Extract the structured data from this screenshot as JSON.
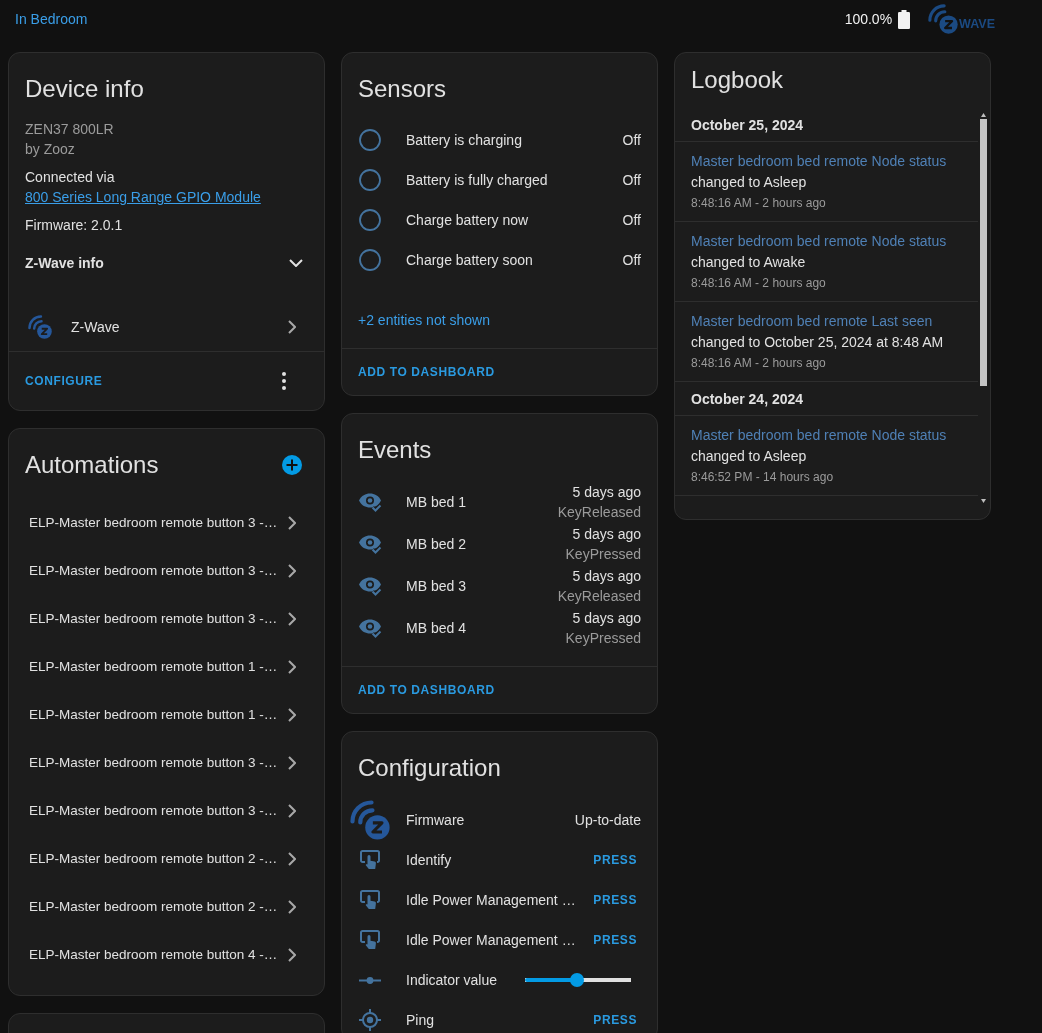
{
  "header": {
    "area_link": "In Bedroom",
    "battery_level": "100.0%",
    "logo_text": "WAVE"
  },
  "device_info": {
    "title": "Device info",
    "model": "ZEN37 800LR",
    "manufacturer": "by Zooz",
    "connected_via": "Connected via",
    "hub_link": "800 Series Long Range GPIO Module",
    "firmware": "Firmware: 2.0.1",
    "zwave_info": {
      "label": "Z-Wave info",
      "expanded": false
    },
    "integration": "Z-Wave",
    "action": "CONFIGURE"
  },
  "automations": {
    "title": "Automations",
    "items": [
      "ELP-Master bedroom remote button 3 -…",
      "ELP-Master bedroom remote button 3 -…",
      "ELP-Master bedroom remote button 3 -…",
      "ELP-Master bedroom remote button 1 -…",
      "ELP-Master bedroom remote button 1 -…",
      "ELP-Master bedroom remote button 3 -…",
      "ELP-Master bedroom remote button 3 -…",
      "ELP-Master bedroom remote button 2 -…",
      "ELP-Master bedroom remote button 2 -…",
      "ELP-Master bedroom remote button 4 -…"
    ]
  },
  "sensors": {
    "title": "Sensors",
    "items": [
      {
        "name": "Battery is charging",
        "state": "Off"
      },
      {
        "name": "Battery is fully charged",
        "state": "Off"
      },
      {
        "name": "Charge battery now",
        "state": "Off"
      },
      {
        "name": "Charge battery soon",
        "state": "Off"
      }
    ],
    "more": "+2 entities not shown",
    "action": "ADD TO DASHBOARD"
  },
  "events": {
    "title": "Events",
    "items": [
      {
        "name": "MB bed 1",
        "time": "5 days ago",
        "event": "KeyReleased"
      },
      {
        "name": "MB bed 2",
        "time": "5 days ago",
        "event": "KeyPressed"
      },
      {
        "name": "MB bed 3",
        "time": "5 days ago",
        "event": "KeyReleased"
      },
      {
        "name": "MB bed 4",
        "time": "5 days ago",
        "event": "KeyPressed"
      }
    ],
    "action": "ADD TO DASHBOARD"
  },
  "configuration": {
    "title": "Configuration",
    "items": [
      {
        "kind": "firmware",
        "name": "Firmware",
        "value": "Up-to-date"
      },
      {
        "kind": "button",
        "name": "Identify",
        "action": "PRESS"
      },
      {
        "kind": "button",
        "name": "Idle Power Management …",
        "action": "PRESS"
      },
      {
        "kind": "button",
        "name": "Idle Power Management …",
        "action": "PRESS"
      },
      {
        "kind": "slider",
        "name": "Indicator value",
        "level": 0.49
      },
      {
        "kind": "ping",
        "name": "Ping",
        "action": "PRESS"
      }
    ]
  },
  "logbook": {
    "title": "Logbook",
    "days": [
      {
        "date": "October 25, 2024",
        "entries": [
          {
            "entity": "Master bedroom bed remote Node status",
            "message": "changed to Asleep",
            "time": "8:48:16 AM - 2 hours ago"
          },
          {
            "entity": "Master bedroom bed remote Node status",
            "message": "changed to Awake",
            "time": "8:48:16 AM - 2 hours ago"
          },
          {
            "entity": "Master bedroom bed remote Last seen",
            "message": "changed to October 25, 2024 at 8:48 AM",
            "time": "8:48:16 AM - 2 hours ago"
          }
        ]
      },
      {
        "date": "October 24, 2024",
        "entries": [
          {
            "entity": "Master bedroom bed remote Node status",
            "message": "changed to Asleep",
            "time": "8:46:52 PM - 14 hours ago"
          }
        ]
      }
    ]
  }
}
